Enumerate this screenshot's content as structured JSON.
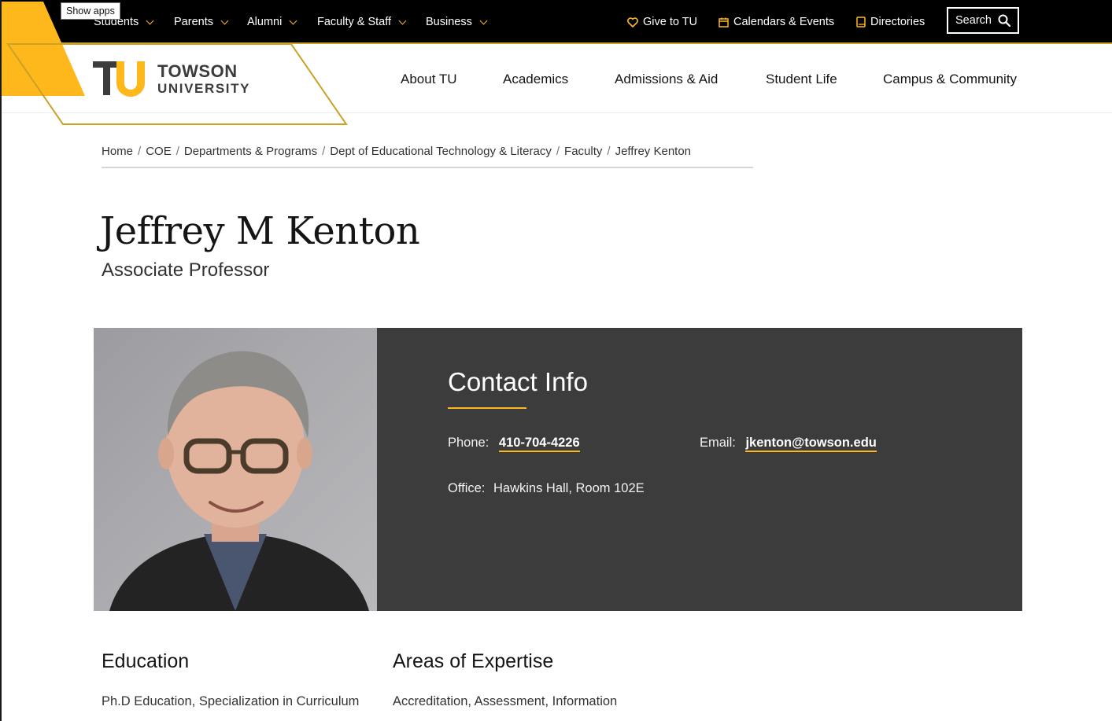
{
  "tooltip": {
    "text": "Show apps"
  },
  "utility_nav": {
    "items": [
      {
        "label": "Students"
      },
      {
        "label": "Parents"
      },
      {
        "label": "Alumni"
      },
      {
        "label": "Faculty & Staff"
      },
      {
        "label": "Business"
      }
    ],
    "right_links": [
      {
        "label": "Give to TU",
        "icon": "heart-icon"
      },
      {
        "label": "Calendars & Events",
        "icon": "calendar-icon"
      },
      {
        "label": "Directories",
        "icon": "book-icon"
      }
    ],
    "search_label": "Search",
    "accent_color": "#ffb81c"
  },
  "logo": {
    "line1": "TOWSON",
    "line2": "UNIVERSITY"
  },
  "main_nav": [
    {
      "label": "About TU"
    },
    {
      "label": "Academics"
    },
    {
      "label": "Admissions & Aid"
    },
    {
      "label": "Student Life"
    },
    {
      "label": "Campus & Community"
    }
  ],
  "breadcrumb": [
    {
      "label": "Home"
    },
    {
      "label": "COE"
    },
    {
      "label": "Departments & Programs"
    },
    {
      "label": "Dept of Educational Technology & Literacy"
    },
    {
      "label": "Faculty"
    },
    {
      "label": "Jeffrey Kenton"
    }
  ],
  "profile": {
    "name": "Jeffrey M Kenton",
    "title": "Associate Professor"
  },
  "contact": {
    "heading": "Contact Info",
    "phone_label": "Phone:",
    "phone": "410-704-4226",
    "email_label": "Email:",
    "email": "jkenton@towson.edu",
    "office_label": "Office:",
    "office": "Hawkins Hall, Room 102E"
  },
  "education": {
    "heading": "Education",
    "line1": "Ph.D Education, Specialization in Curriculum"
  },
  "expertise": {
    "heading": "Areas of Expertise",
    "line1": "Accreditation, Assessment, Information"
  }
}
